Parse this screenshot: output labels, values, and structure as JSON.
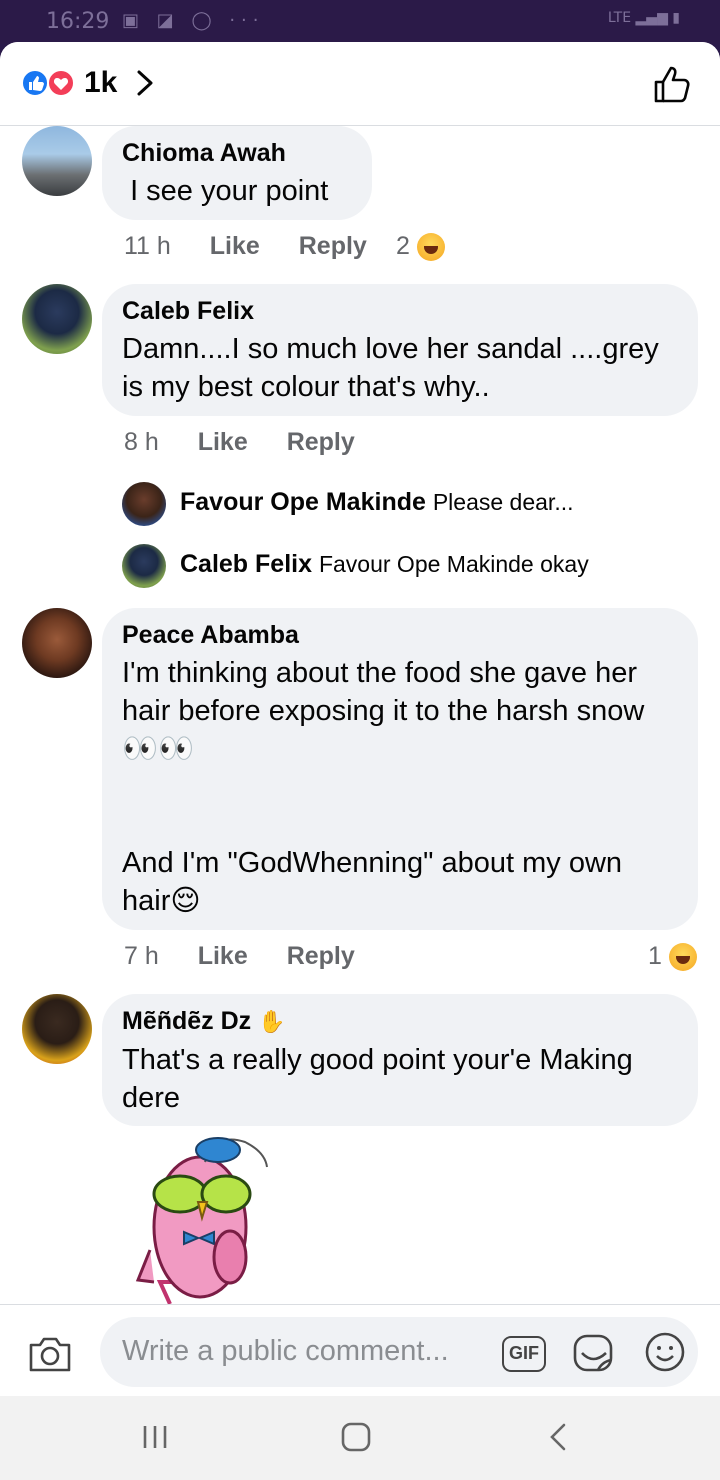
{
  "status_bar": {
    "time": "16:29",
    "network": "LTE"
  },
  "header": {
    "reaction_count": "1k",
    "reactions": [
      "like-icon",
      "love-icon"
    ]
  },
  "comments": [
    {
      "name": "Chioma Awah",
      "text": " I see your point",
      "time": "11 h",
      "like": "Like",
      "reply": "Reply",
      "reaction_count": "2"
    },
    {
      "name": "Caleb Felix",
      "text": "Damn....I so much love her sandal ....grey\nis my best colour that's why..",
      "time": "8 h",
      "like": "Like",
      "reply": "Reply"
    },
    {
      "name": "Peace Abamba",
      "text": "I'm thinking about the food she gave her\nhair before exposing it to the harsh snow\n👀👀\n\n\nAnd I'm \"GodWhenning\" about my own\nhair😌",
      "time": "7 h",
      "like": "Like",
      "reply": "Reply",
      "reaction_count": "1"
    },
    {
      "name": "Mẽñdẽz Dz",
      "text": "That's a really good point your'e Making\ndere"
    }
  ],
  "replies": [
    {
      "name": "Favour Ope Makinde",
      "text": "Please dear..."
    },
    {
      "name": "Caleb Felix",
      "text": "Favour Ope Makinde okay"
    }
  ],
  "composer": {
    "placeholder": "Write a public comment...",
    "gif_label": "GIF"
  },
  "colors": {
    "status_bar": "#2b1a48",
    "bubble": "#f0f2f5",
    "meta": "#65676b",
    "like_blue": "#1877f2",
    "love_red": "#f33e58"
  }
}
